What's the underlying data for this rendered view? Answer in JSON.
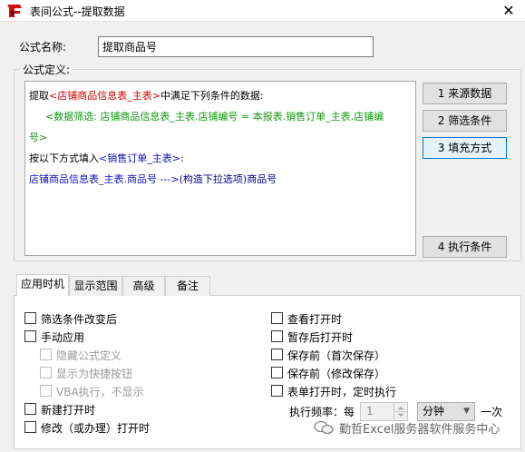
{
  "window": {
    "title": "表间公式--提取数据",
    "close_symbol": "✕"
  },
  "formula_name": {
    "label": "公式名称:",
    "value": "提取商品号"
  },
  "definition": {
    "legend": "公式定义:",
    "line1": {
      "prefix": "提取",
      "table": "<店铺商品信息表_主表>",
      "suffix": "中满足下列条件的数据:"
    },
    "line2": "<数据筛选: 店铺商品信息表_主表.店铺编号 = 本报表.销售订单_主表.店铺编",
    "line3": "号>",
    "line4": {
      "prefix": "按以下方式填入",
      "table": "<销售订单_主表>",
      "suffix": ":"
    },
    "line5": {
      "main": "店铺商品信息表_主表.商品号  --->",
      "tail": "(构造下拉选项)商品号"
    }
  },
  "side_buttons": {
    "source": "1  来源数据",
    "filter": "2  筛选条件",
    "fill": "3  填充方式",
    "exec": "4  执行条件"
  },
  "tabs": {
    "timing": "应用时机",
    "scope": "显示范围",
    "advanced": "高级",
    "notes": "备注"
  },
  "options": {
    "filter_change": "筛选条件改变后",
    "manual": "手动应用",
    "hide_formula": "隐藏公式定义",
    "shortcut": "显示为快捷按钮",
    "vba_hidden": "VBA执行，不显示",
    "new_open": "新建打开时",
    "modify_open": "修改（或办理）打开时",
    "view_open": "查看打开时",
    "draft_open": "暂存后打开时",
    "before_save_first": "保存前（首次保存）",
    "before_save_modify": "保存前（修改保存）",
    "form_open_timer": "表单打开时，定时执行"
  },
  "frequency": {
    "label": "执行频率：每",
    "value": "1",
    "unit": "分钟",
    "suffix": "一次"
  },
  "watermark": "勤哲Excel服务器软件服务中心"
}
